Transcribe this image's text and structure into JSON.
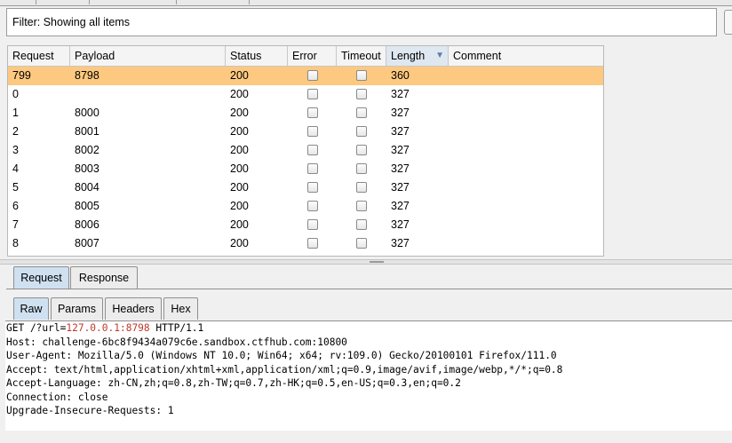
{
  "filter": {
    "text": "Filter: Showing all items"
  },
  "table": {
    "columns": [
      "Request",
      "Payload",
      "Status",
      "Error",
      "Timeout",
      "Length",
      "Comment"
    ],
    "sorted_column": "Length",
    "rows": [
      {
        "request": "799",
        "payload": "8798",
        "status": "200",
        "error": false,
        "timeout": false,
        "length": "360",
        "comment": "",
        "selected": true
      },
      {
        "request": "0",
        "payload": "",
        "status": "200",
        "error": false,
        "timeout": false,
        "length": "327",
        "comment": "",
        "selected": false
      },
      {
        "request": "1",
        "payload": "8000",
        "status": "200",
        "error": false,
        "timeout": false,
        "length": "327",
        "comment": "",
        "selected": false
      },
      {
        "request": "2",
        "payload": "8001",
        "status": "200",
        "error": false,
        "timeout": false,
        "length": "327",
        "comment": "",
        "selected": false
      },
      {
        "request": "3",
        "payload": "8002",
        "status": "200",
        "error": false,
        "timeout": false,
        "length": "327",
        "comment": "",
        "selected": false
      },
      {
        "request": "4",
        "payload": "8003",
        "status": "200",
        "error": false,
        "timeout": false,
        "length": "327",
        "comment": "",
        "selected": false
      },
      {
        "request": "5",
        "payload": "8004",
        "status": "200",
        "error": false,
        "timeout": false,
        "length": "327",
        "comment": "",
        "selected": false
      },
      {
        "request": "6",
        "payload": "8005",
        "status": "200",
        "error": false,
        "timeout": false,
        "length": "327",
        "comment": "",
        "selected": false
      },
      {
        "request": "7",
        "payload": "8006",
        "status": "200",
        "error": false,
        "timeout": false,
        "length": "327",
        "comment": "",
        "selected": false
      },
      {
        "request": "8",
        "payload": "8007",
        "status": "200",
        "error": false,
        "timeout": false,
        "length": "327",
        "comment": "",
        "selected": false
      }
    ]
  },
  "message_tabs": {
    "request": "Request",
    "response": "Response",
    "active": "Request"
  },
  "view_tabs": {
    "raw": "Raw",
    "params": "Params",
    "headers": "Headers",
    "hex": "Hex",
    "active": "Raw"
  },
  "request_text": {
    "line1_prefix": "GET /?url=",
    "line1_highlight": "127.0.0.1:8798",
    "line1_suffix": " HTTP/1.1",
    "lines": [
      "Host: challenge-6bc8f9434a079c6e.sandbox.ctfhub.com:10800",
      "User-Agent: Mozilla/5.0 (Windows NT 10.0; Win64; x64; rv:109.0) Gecko/20100101 Firefox/111.0",
      "Accept: text/html,application/xhtml+xml,application/xml;q=0.9,image/avif,image/webp,*/*;q=0.8",
      "Accept-Language: zh-CN,zh;q=0.8,zh-TW;q=0.7,zh-HK;q=0.5,en-US;q=0.3,en;q=0.2",
      "Connection: close",
      "Upgrade-Insecure-Requests: 1"
    ]
  },
  "colors": {
    "selected_row": "#fdc87f",
    "active_tab": "#cfe0f1",
    "highlight_text": "#c0392b"
  }
}
